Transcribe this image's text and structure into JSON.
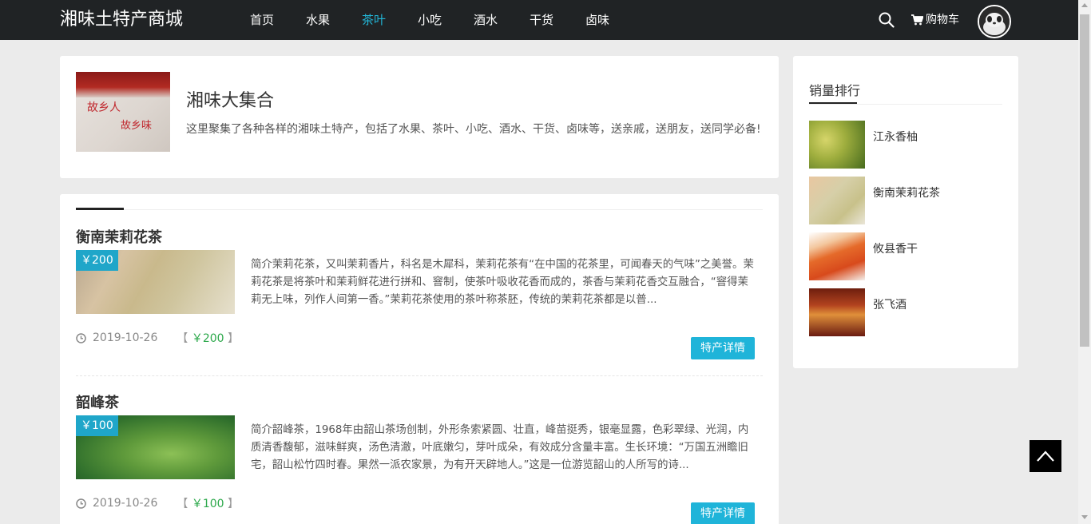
{
  "brand": "湘味土特产商城",
  "nav": [
    "首页",
    "水果",
    "茶叶",
    "小吃",
    "酒水",
    "干货",
    "卤味"
  ],
  "nav_active": 2,
  "cart_label": "购物车",
  "intro": {
    "title": "湘味大集合",
    "desc": "这里聚集了各种各样的湘味土特产，包括了水果、茶叶、小吃、酒水、干货、卤味等，送亲戚，送朋友，送同学必备!",
    "image_text_1": "故乡人",
    "image_text_2": "故乡味"
  },
  "products": [
    {
      "name": "衡南茉莉花茶",
      "badge": "￥200",
      "desc": "简介茉莉花茶，又叫茉莉香片，科名是木犀科，茉莉花茶有“在中国的花茶里，可闻春天的气味”之美誉。茉莉花茶是将茶叶和茉莉鲜花进行拼和、窨制，使茶叶吸收花香而成的，茶香与茉莉花香交互融合，“窨得茉莉无上味，列作人间第一香。”茉莉花茶使用的茶叶称茶胚，传统的茉莉花茶都是以普...",
      "date": "2019-10-26",
      "price_open": "【",
      "price": "￥200",
      "price_close": "】",
      "button": "特产详情"
    },
    {
      "name": "韶峰茶",
      "badge": "￥100",
      "desc": "简介韶峰茶，1968年由韶山茶场创制，外形条索紧圆、壮直，峰苗挺秀，银毫显露，色彩翠绿、光润，内质清香馥郁，滋味鲜爽，汤色清澈，叶底嫩匀，芽叶成朵，有效成分含量丰富。生长环境：“万国五洲瞻旧宅，韶山松竹四时春。果然一派农家景，为有开天辟地人。”这是一位游览韶山的人所写的诗...",
      "date": "2019-10-26",
      "price_open": "【",
      "price": "￥100",
      "price_close": "】",
      "button": "特产详情"
    }
  ],
  "sidebar": {
    "title": "销量排行",
    "items": [
      "江永香柚",
      "衡南茉莉花茶",
      "攸县香干",
      "张飞酒"
    ]
  },
  "colors": {
    "header_bg": "#202325",
    "accent": "#1fb4d9",
    "active_nav": "#22b5d6",
    "price_green": "#2ba84a"
  }
}
